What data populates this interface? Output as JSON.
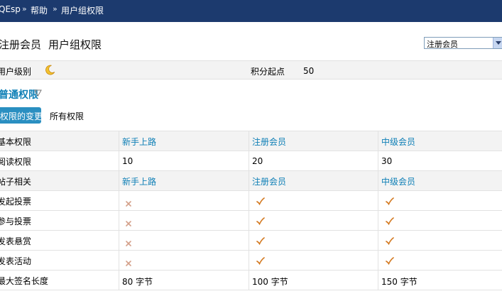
{
  "breadcrumb": {
    "home": "QEsp",
    "sep": "»",
    "level1": "帮助",
    "level2": "用户组权限"
  },
  "page_title": {
    "group": "注册会员",
    "title": "用户组权限"
  },
  "group_select": {
    "value": "注册会员"
  },
  "info": {
    "level_label": "用户级别",
    "points_label": "积分起点",
    "points_value": "50"
  },
  "section": {
    "title": "普通权限"
  },
  "tabs": {
    "changes": "权限的变更",
    "all": "所有权限"
  },
  "table": {
    "rows": [
      {
        "label": "基本权限",
        "cells": [
          "新手上路",
          "注册会员",
          "中级会员"
        ],
        "type": "head"
      },
      {
        "label": "阅读权限",
        "cells": [
          "10",
          "20",
          "30"
        ],
        "type": "text"
      },
      {
        "label": "帖子相关",
        "cells": [
          "新手上路",
          "注册会员",
          "中级会员"
        ],
        "type": "head"
      },
      {
        "label": "发起投票",
        "cells": [
          "no",
          "yes",
          "yes"
        ],
        "type": "mark"
      },
      {
        "label": "参与投票",
        "cells": [
          "no",
          "yes",
          "yes"
        ],
        "type": "mark"
      },
      {
        "label": "发表悬赏",
        "cells": [
          "no",
          "yes",
          "yes"
        ],
        "type": "mark"
      },
      {
        "label": "发表活动",
        "cells": [
          "no",
          "yes",
          "yes"
        ],
        "type": "mark"
      },
      {
        "label": "最大签名长度",
        "cells": [
          "80 字节",
          "100 字节",
          "150 字节"
        ],
        "type": "text"
      }
    ]
  },
  "colors": {
    "topbar": "#1c3a6e",
    "accent": "#0e7fb6",
    "tab_active": "#2a8fc1",
    "check": "#d3781f",
    "cross": "#d4a08a"
  },
  "icons": {
    "level": "moon-icon",
    "yes": "check-icon",
    "no": "cross-icon",
    "section_toggle": "triangle-down-icon",
    "select": "chevron-down-icon"
  }
}
